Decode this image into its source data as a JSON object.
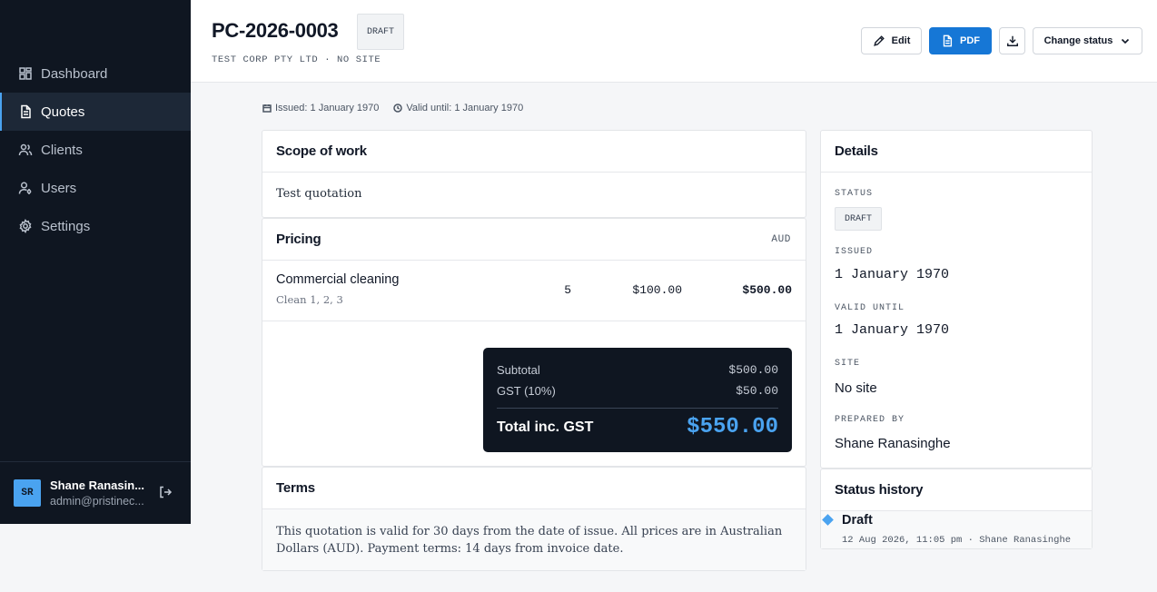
{
  "sidebar": {
    "items": [
      {
        "label": "Dashboard",
        "icon": "grid-icon"
      },
      {
        "label": "Quotes",
        "icon": "document-icon"
      },
      {
        "label": "Clients",
        "icon": "users-icon"
      },
      {
        "label": "Users",
        "icon": "user-key-icon"
      },
      {
        "label": "Settings",
        "icon": "gear-icon"
      }
    ],
    "user": {
      "initials": "SR",
      "name": "Shane Ranasin...",
      "email": "admin@pristinec..."
    }
  },
  "header": {
    "title": "PC-2026-0003",
    "badge": "DRAFT",
    "subtitle": "TEST CORP PTY LTD · NO SITE",
    "buttons": {
      "edit": "Edit",
      "pdf": "PDF",
      "change_status": "Change status"
    }
  },
  "dates": {
    "issued": "Issued: 1 January 1970",
    "valid_until": "Valid until: 1 January 1970"
  },
  "scope": {
    "heading": "Scope of work",
    "text": "Test quotation"
  },
  "pricing": {
    "heading": "Pricing",
    "currency": "AUD",
    "line_items": [
      {
        "name": "Commercial cleaning",
        "description": "Clean 1, 2, 3",
        "qty": "5",
        "unit_price": "$100.00",
        "total": "$500.00"
      }
    ],
    "totals": {
      "subtotal_label": "Subtotal",
      "subtotal": "$500.00",
      "gst_label": "GST (10%)",
      "gst": "$50.00",
      "total_label": "Total inc. GST",
      "total": "$550.00"
    }
  },
  "terms": {
    "heading": "Terms",
    "text": "This quotation is valid for 30 days from the date of issue. All prices are in Australian Dollars (AUD). Payment terms: 14 days from invoice date."
  },
  "details": {
    "heading": "Details",
    "status_label": "STATUS",
    "status": "DRAFT",
    "issued_label": "ISSUED",
    "issued": "1 January 1970",
    "valid_label": "VALID UNTIL",
    "valid": "1 January 1970",
    "site_label": "SITE",
    "site": "No site",
    "prepared_label": "PREPARED BY",
    "prepared": "Shane Ranasinghe"
  },
  "history": {
    "heading": "Status history",
    "entries": [
      {
        "status": "Draft",
        "meta": "12 Aug 2026, 11:05 pm · Shane Ranasinghe"
      }
    ]
  },
  "colors": {
    "sidebar_bg": "#0f1621",
    "accent": "#4aa3f0",
    "primary_button": "#1677d6"
  }
}
